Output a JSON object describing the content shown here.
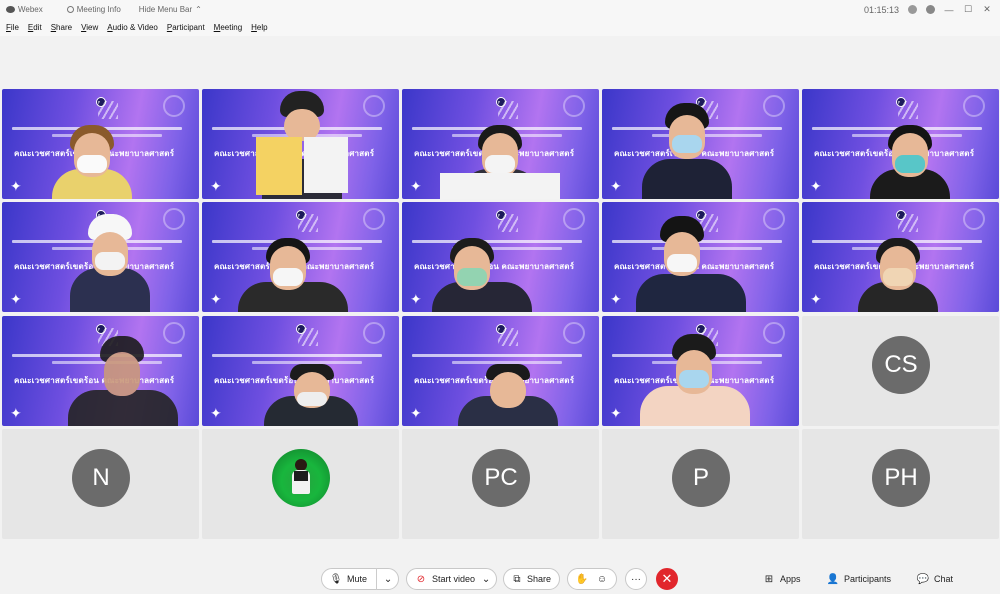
{
  "titlebar": {
    "app_name": "Webex",
    "meeting_info": "Meeting Info",
    "hide_menu_bar": "Hide Menu Bar",
    "clock": "01:15:13"
  },
  "menu": [
    "File",
    "Edit",
    "Share",
    "View",
    "Audio & Video",
    "Participant",
    "Meeting",
    "Help"
  ],
  "video_banner_title": "คณะเวชศาสตร์เขตร้อน คณะพยาบาลศาสตร์",
  "avatars": [
    "CS",
    "N",
    "PC",
    "P",
    "PH"
  ],
  "controls": {
    "mute": "Mute",
    "start_video": "Start video",
    "share": "Share",
    "more": "···",
    "apps": "Apps",
    "participants": "Participants",
    "chat": "Chat"
  },
  "colors": {
    "accent_end": "#e1262c",
    "avatar_gray": "#6b6b6b",
    "video_bg": "#6f4fe0"
  }
}
